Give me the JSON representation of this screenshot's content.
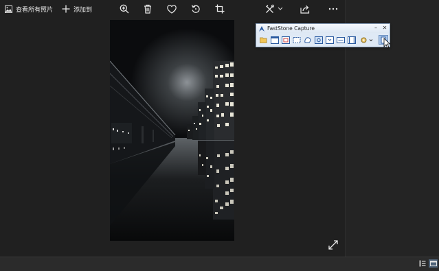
{
  "toolbar": {
    "see_all_photos": "查看所有照片",
    "add_to": "添加到",
    "icons": [
      "photo-icon",
      "plus-icon",
      "zoom-in-icon",
      "delete-icon",
      "favorite-icon",
      "rotate-icon",
      "crop-icon",
      "edit-create-icon",
      "share-icon",
      "more-icon"
    ]
  },
  "faststone": {
    "title": "FastStone Capture",
    "minimize": "–",
    "close": "✕"
  },
  "colors": {
    "background": "#202020",
    "statusbar": "#2b2b2b",
    "fsc_panel": "#dfe9f5",
    "fsc_selected": "#aac6ea"
  }
}
